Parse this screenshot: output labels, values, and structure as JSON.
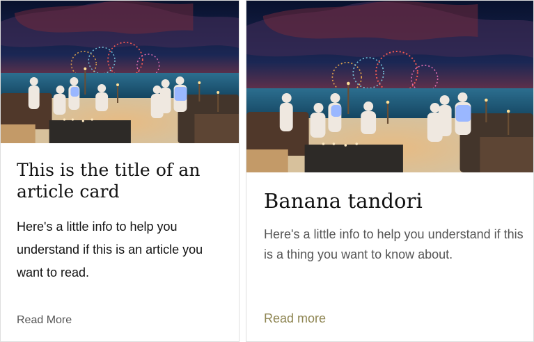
{
  "cards": [
    {
      "title": "This is the title of an article card",
      "text": "Here's a little info to help you understand if this is an article you want to read.",
      "link_label": "Read More"
    },
    {
      "title": "Banana tandori",
      "text": "Here's a little info to help you understand if this is a thing you want to know about.",
      "link_label": "Read more"
    }
  ],
  "colors": {
    "title": "#111111",
    "body_primary": "#111111",
    "body_secondary": "#555555",
    "link_secondary": "#555555",
    "link_accent": "#8e8552",
    "border": "#dedede"
  }
}
